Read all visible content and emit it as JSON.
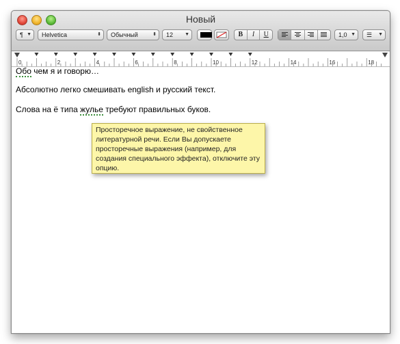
{
  "window": {
    "title": "Новый"
  },
  "toolbar": {
    "paragraph_style": "¶",
    "font_family": "Helvetica",
    "font_style": "Обычный",
    "font_size": "12",
    "text_color": "#000000",
    "bold_label": "B",
    "italic_label": "I",
    "underline_label": "U",
    "line_spacing": "1,0",
    "list_style": "☰"
  },
  "ruler": {
    "labels": [
      "0",
      "2",
      "4",
      "6",
      "8",
      "10",
      "12",
      "14",
      "16",
      "18"
    ]
  },
  "document": {
    "line1": {
      "misspelled": "Обо",
      "rest": " чем я и говорю…"
    },
    "line2": "Абсолютно легко смешивать english и русский текст.",
    "line3": {
      "before": "Слова на ё типа ",
      "flagged": "жулье",
      "after": " требуют правильных буков."
    }
  },
  "tooltip": {
    "text": "Просторечное выражение, не свойственное литературной речи. Если Вы допускаете просторечные выражения (например, для создания специального эффекта), отключите эту опцию."
  }
}
